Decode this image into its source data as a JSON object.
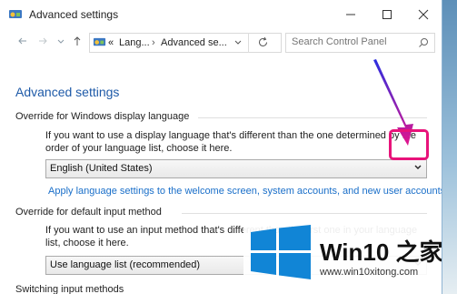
{
  "window": {
    "title": "Advanced settings"
  },
  "address": {
    "segment_root": "«",
    "segment_lang": "Lang...",
    "segment_adv": "Advanced se...",
    "separator": "›"
  },
  "search": {
    "placeholder": "Search Control Panel"
  },
  "main": {
    "title": "Advanced settings",
    "display_section": {
      "heading": "Override for Windows display language",
      "description": "If you want to use a display language that's different than the one determined by the order of your language list, choose it here.",
      "selected": "English (United States)",
      "link": "Apply language settings to the welcome screen, system accounts, and new user accounts"
    },
    "input_section": {
      "heading": "Override for default input method",
      "description": "If you want to use an input method that's different than the first one in your language list, choose it here.",
      "selected": "Use language list (recommended)"
    },
    "switching_section": {
      "heading": "Switching input methods"
    }
  },
  "watermark": {
    "title": "Win10 之家",
    "url": "www.win10xitong.com"
  },
  "colors": {
    "accent": "#1e5aa8",
    "link": "#1a6fc9",
    "highlight": "#e8137a"
  }
}
